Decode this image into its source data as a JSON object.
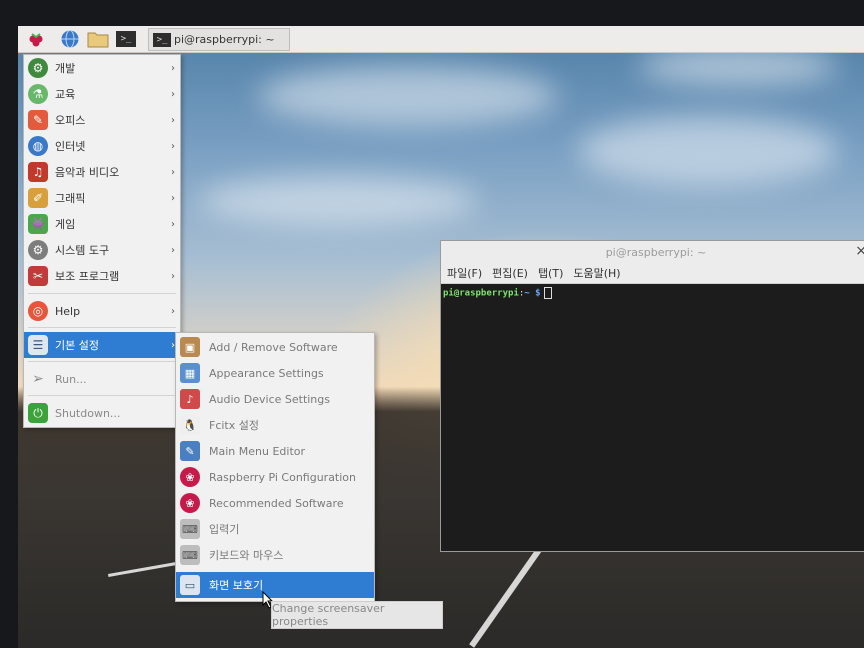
{
  "panel": {
    "task_title": "pi@raspberrypi: ~",
    "terminal_glyph": ">_"
  },
  "menu": {
    "items": [
      {
        "label": "개발",
        "icon": "development-icon"
      },
      {
        "label": "교육",
        "icon": "education-icon"
      },
      {
        "label": "오피스",
        "icon": "office-icon"
      },
      {
        "label": "인터넷",
        "icon": "internet-icon"
      },
      {
        "label": "음악과 비디오",
        "icon": "sound-video-icon"
      },
      {
        "label": "그래픽",
        "icon": "graphics-icon"
      },
      {
        "label": "게임",
        "icon": "games-icon"
      },
      {
        "label": "시스템 도구",
        "icon": "system-tools-icon"
      },
      {
        "label": "보조 프로그램",
        "icon": "accessories-icon"
      },
      {
        "label": "Help",
        "icon": "help-icon"
      },
      {
        "label": "기본 설정",
        "icon": "preferences-icon"
      },
      {
        "label": "Run...",
        "icon": "run-icon"
      },
      {
        "label": "Shutdown...",
        "icon": "shutdown-icon"
      }
    ]
  },
  "submenu": {
    "items": [
      {
        "label": "Add / Remove Software",
        "icon": "package-icon"
      },
      {
        "label": "Appearance Settings",
        "icon": "appearance-icon"
      },
      {
        "label": "Audio Device Settings",
        "icon": "audio-icon"
      },
      {
        "label": "Fcitx 설정",
        "icon": "penguin-icon"
      },
      {
        "label": "Main Menu Editor",
        "icon": "menu-editor-icon"
      },
      {
        "label": "Raspberry Pi Configuration",
        "icon": "raspberry-icon"
      },
      {
        "label": "Recommended Software",
        "icon": "raspberry-icon"
      },
      {
        "label": "입력기",
        "icon": "keyboard-icon"
      },
      {
        "label": "키보드와 마우스",
        "icon": "keyboard-mouse-icon"
      },
      {
        "label": "화면 보호기",
        "icon": "screensaver-icon"
      }
    ]
  },
  "tooltip": "Change screensaver properties",
  "terminal": {
    "title": "pi@raspberrypi: ~",
    "menu": [
      "파일(F)",
      "편집(E)",
      "탭(T)",
      "도움말(H)"
    ],
    "prompt_user": "pi@raspberrypi",
    "prompt_sep": ":",
    "prompt_path": "~ $",
    "close": "×"
  },
  "colors": {
    "selection": "#2f7dd3",
    "terminal_bg": "#1c1c1c",
    "prompt_green": "#7ee36e",
    "prompt_blue": "#6aa4ff"
  }
}
